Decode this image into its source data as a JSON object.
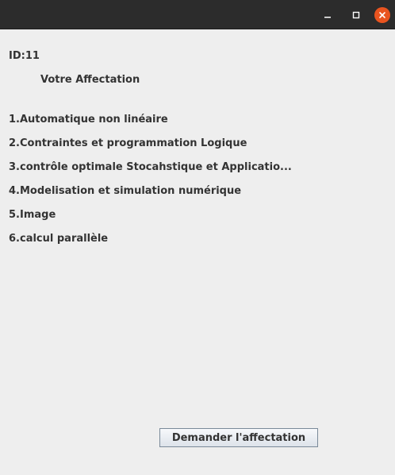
{
  "window": {
    "controls": {
      "minimize_icon": "minimize-icon",
      "maximize_icon": "maximize-icon",
      "close_icon": "close-icon",
      "close_color": "#e9541f"
    }
  },
  "main": {
    "id_label": "ID:11",
    "heading": "Votre Affectation",
    "courses": [
      "1.Automatique non linéaire",
      "2.Contraintes et programmation Logique",
      "3.contrôle optimale Stocahstique et Applicatio...",
      "4.Modelisation et simulation numérique",
      "5.Image",
      "6.calcul parallèle"
    ],
    "request_button_label": "Demander l'affectation"
  }
}
